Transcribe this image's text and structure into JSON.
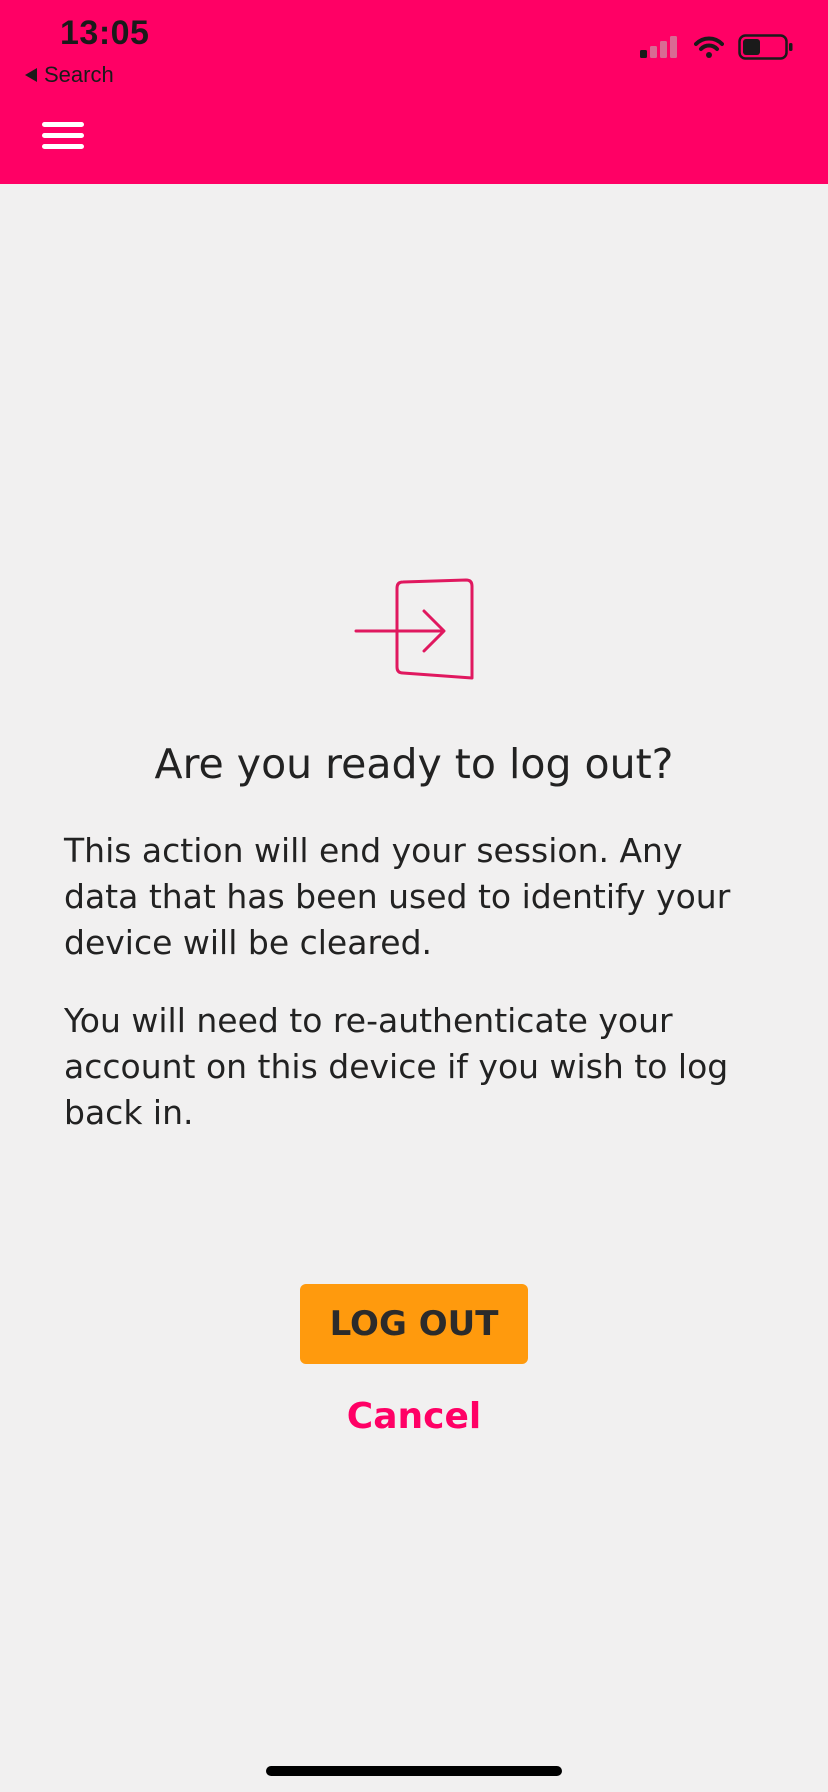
{
  "status_bar": {
    "time": "13:05",
    "back_label": "Search",
    "icons": [
      "back-arrow-icon",
      "cellular-signal-icon",
      "wifi-icon",
      "battery-icon"
    ]
  },
  "header": {
    "background_color": "#ff0065",
    "menu_icon": "hamburger-menu-icon"
  },
  "dialog": {
    "icon": "logout-door-icon",
    "title": "Are you ready to log out?",
    "paragraph_1": "This action will end your session. Any data that has been used to identify your device will be cleared.",
    "paragraph_2": "You will need to re-authenticate your account on this device if you wish to log back in."
  },
  "actions": {
    "logout_label": "LOG OUT",
    "cancel_label": "Cancel",
    "logout_color": "#ff9a0d",
    "cancel_color": "#ff0065"
  }
}
